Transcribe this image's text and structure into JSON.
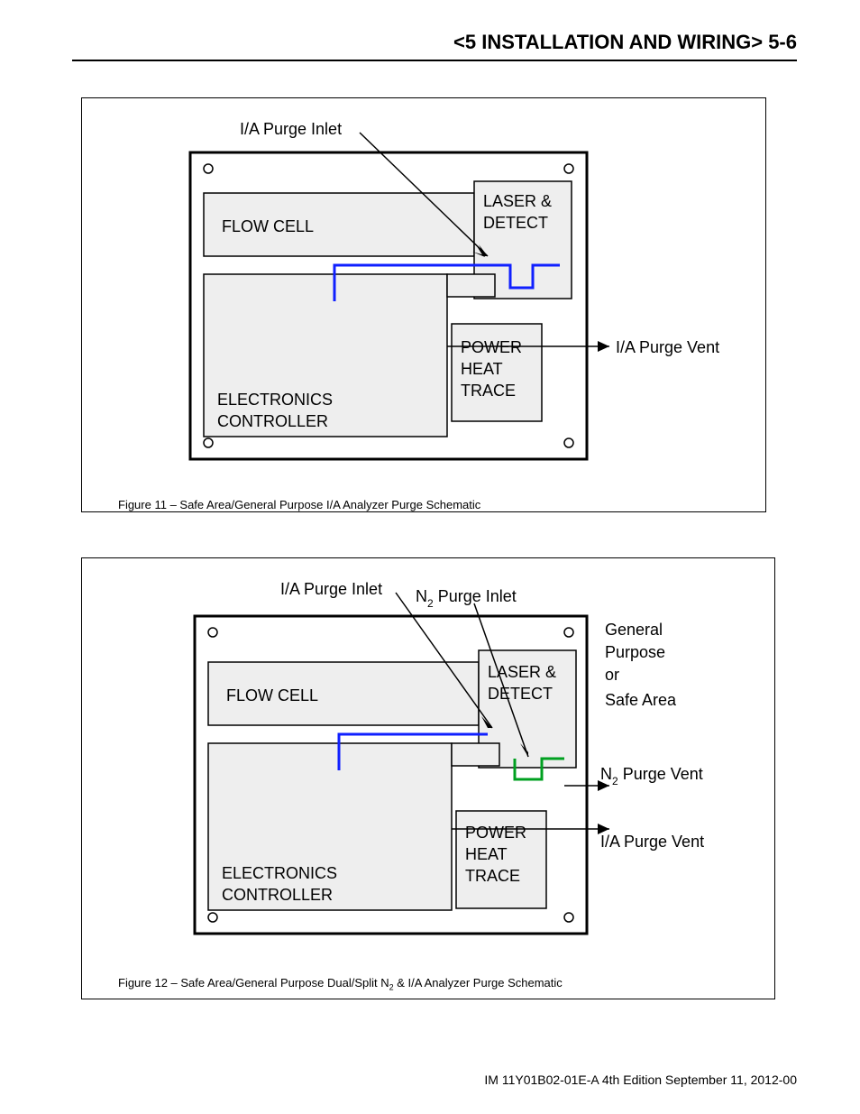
{
  "header": {
    "title": "<5 INSTALLATION AND WIRING>  5-6"
  },
  "figure11": {
    "label_purge_inlet": "I/A Purge Inlet",
    "label_flow_cell": "FLOW CELL",
    "label_laser_detect_1": "LASER &",
    "label_laser_detect_2": "DETECT",
    "label_power": "POWER",
    "label_heat": "HEAT",
    "label_trace": "TRACE",
    "label_electronics": "ELECTRONICS",
    "label_controller": "CONTROLLER",
    "label_purge_vent": "I/A Purge Vent",
    "caption": "Figure 11 – Safe Area/General Purpose I/A Analyzer Purge Schematic"
  },
  "figure12": {
    "label_ia_purge_inlet": "I/A Purge Inlet",
    "label_n2_purge_inlet_pre": "N",
    "label_n2_purge_inlet_post": " Purge Inlet",
    "label_flow_cell": "FLOW CELL",
    "label_laser_detect_1": "LASER &",
    "label_laser_detect_2": "DETECT",
    "label_power": "POWER",
    "label_heat": "HEAT",
    "label_trace": "TRACE",
    "label_electronics": "ELECTRONICS",
    "label_controller": "CONTROLLER",
    "label_general": "General",
    "label_purpose": "Purpose",
    "label_or": "or",
    "label_safe_area": "Safe Area",
    "label_n2_vent_pre": "N",
    "label_n2_vent_post": " Purge Vent",
    "label_ia_purge_vent": "I/A Purge Vent",
    "caption_pre": "Figure 12 – Safe Area/General Purpose Dual/Split N",
    "caption_post": " & I/A Analyzer Purge Schematic"
  },
  "footer": {
    "text": "IM 11Y01B02-01E-A  4th Edition September 11, 2012-00"
  }
}
